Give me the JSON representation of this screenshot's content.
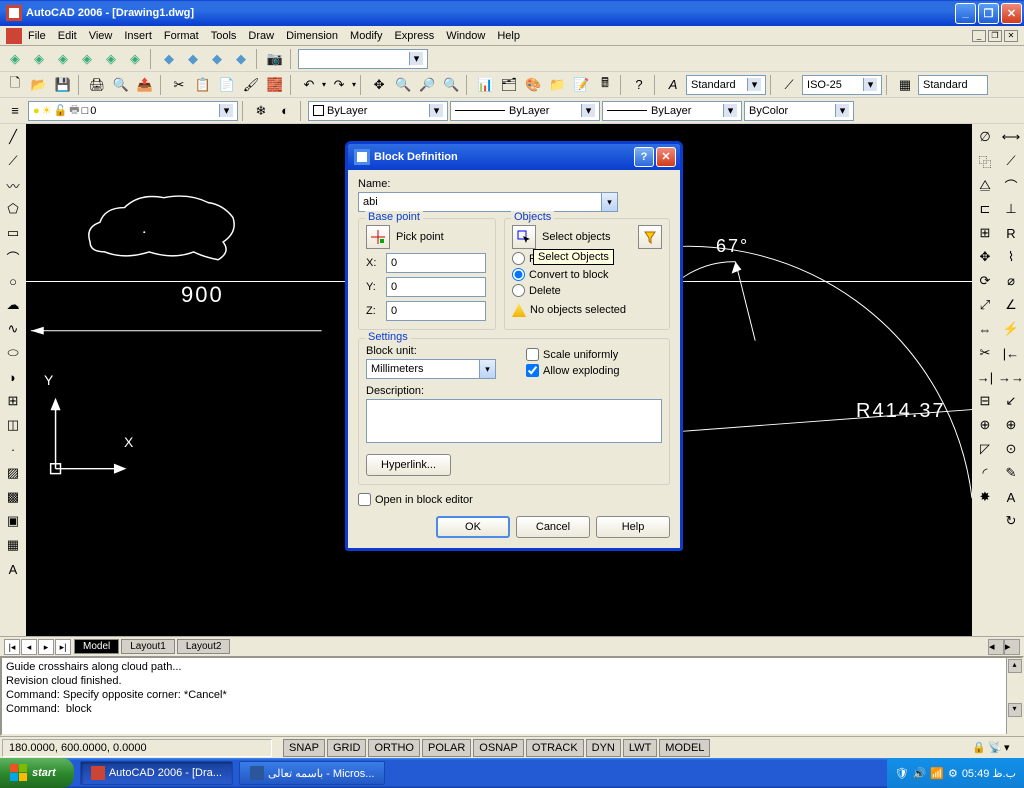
{
  "window": {
    "title": "AutoCAD 2006 - [Drawing1.dwg]"
  },
  "menu": {
    "items": [
      "File",
      "Edit",
      "View",
      "Insert",
      "Format",
      "Tools",
      "Draw",
      "Dimension",
      "Modify",
      "Express",
      "Window",
      "Help"
    ]
  },
  "toolbars": {
    "style_combo1": "Standard",
    "style_combo2": "ISO-25",
    "style_combo3": "Standard",
    "layer_combo": "0",
    "prop_combo1": "ByLayer",
    "prop_combo2": "ByLayer",
    "prop_combo3": "ByLayer",
    "prop_combo4": "ByColor"
  },
  "tabs": {
    "items": [
      "Model",
      "Layout1",
      "Layout2"
    ],
    "active": 0
  },
  "drawing": {
    "dim_900": "900",
    "angle_67": "67°",
    "radius": "R414.37",
    "axis_x": "X",
    "axis_y": "Y"
  },
  "cmd": {
    "line1": "Guide crosshairs along cloud path...",
    "line2": "Revision cloud finished.",
    "line3": "Command: Specify opposite corner: *Cancel*",
    "line4": "Command:  block"
  },
  "status": {
    "coords": "180.0000, 600.0000, 0.0000",
    "toggles": [
      "SNAP",
      "GRID",
      "ORTHO",
      "POLAR",
      "OSNAP",
      "OTRACK",
      "DYN",
      "LWT",
      "MODEL"
    ]
  },
  "dialog": {
    "title": "Block Definition",
    "name_label": "Name:",
    "name_value": "abi",
    "bp_legend": "Base point",
    "pick_point": "Pick point",
    "x_label": "X:",
    "x_val": "0",
    "y_label": "Y:",
    "y_val": "0",
    "z_label": "Z:",
    "z_val": "0",
    "obj_legend": "Objects",
    "select_objects": "Select objects",
    "tooltip": "Select Objects",
    "r_retain": "Retain",
    "r_convert": "Convert to block",
    "r_delete": "Delete",
    "warn": "No objects selected",
    "settings_legend": "Settings",
    "block_unit_label": "Block unit:",
    "block_unit_value": "Millimeters",
    "scale_uniform": "Scale uniformly",
    "allow_explode": "Allow exploding",
    "desc_label": "Description:",
    "hyperlink": "Hyperlink...",
    "open_editor": "Open in block editor",
    "ok": "OK",
    "cancel": "Cancel",
    "help": "Help"
  },
  "taskbar": {
    "start": "start",
    "task1": "AutoCAD 2006 - [Dra...",
    "task2": "باسمه تعالی - Micros...",
    "time": "05:49 ب.ظ"
  }
}
